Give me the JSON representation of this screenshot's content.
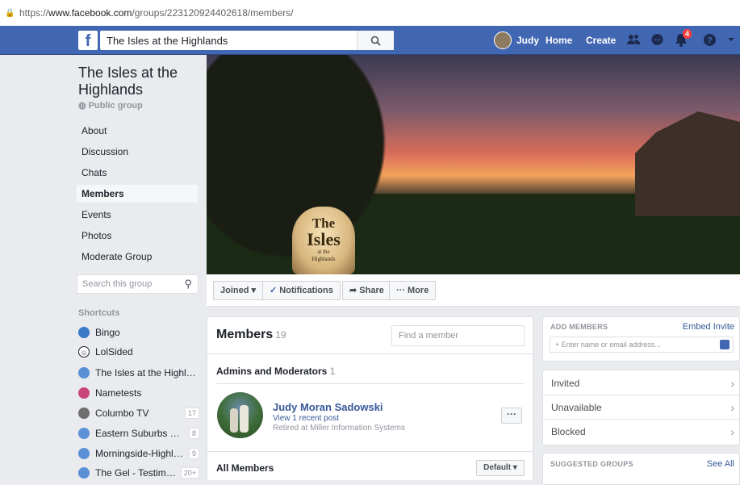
{
  "browser": {
    "url_scheme": "https://",
    "url_host": "www.facebook.com",
    "url_path": "/groups/223120924402618/members/"
  },
  "topbar": {
    "logo": "f",
    "search_value": "The Isles at the Highlands",
    "user_name": "Judy",
    "home_label": "Home",
    "create_label": "Create",
    "notification_count": "4"
  },
  "group": {
    "title": "The Isles at the Highlands",
    "privacy": "Public group",
    "menu": [
      "About",
      "Discussion",
      "Chats",
      "Members",
      "Events",
      "Photos",
      "Moderate Group"
    ],
    "active_menu": "Members",
    "search_placeholder": "Search this group"
  },
  "shortcuts": {
    "heading": "Shortcuts",
    "items": [
      {
        "label": "Bingo",
        "count": "",
        "color": "#3b78c7"
      },
      {
        "label": "LolSided",
        "count": "",
        "color": "#ffffff"
      },
      {
        "label": "The Isles at the Highlands",
        "count": "",
        "color": "#5b8fd6"
      },
      {
        "label": "Nametests",
        "count": "",
        "color": "#c9467b"
      },
      {
        "label": "Columbo TV",
        "count": "17",
        "color": "#6e6e6e"
      },
      {
        "label": "Eastern Suburbs NE...",
        "count": "8",
        "color": "#5b8fd6"
      },
      {
        "label": "Morningside-Highlan...",
        "count": "9",
        "color": "#5b8fd6"
      },
      {
        "label": "The Gel - Testimoni...",
        "count": "20+",
        "color": "#5b8fd6"
      }
    ]
  },
  "cover": {
    "rock_line1": "The",
    "rock_line2": "Isles",
    "rock_line3": "at the",
    "rock_line4": "Highlands"
  },
  "actions": {
    "joined": "Joined ▾",
    "notifications": "Notifications",
    "share": "Share",
    "more": "··· More"
  },
  "members": {
    "title": "Members",
    "count": "19",
    "find_placeholder": "Find a member",
    "admins_heading": "Admins and Moderators",
    "admins_count": "1",
    "admin": {
      "name": "Judy Moran Sadowski",
      "line2": "View 1 recent post",
      "line3": "Retired at Miller Information Systems",
      "more_button": "···"
    },
    "all_heading": "All Members",
    "sort_label": "Default ▾"
  },
  "right": {
    "add_heading": "ADD MEMBERS",
    "embed_link": "Embed Invite",
    "add_placeholder": "+ Enter name or email address...",
    "rows": [
      "Invited",
      "Unavailable",
      "Blocked"
    ],
    "suggested_heading": "SUGGESTED GROUPS",
    "see_all": "See All"
  }
}
